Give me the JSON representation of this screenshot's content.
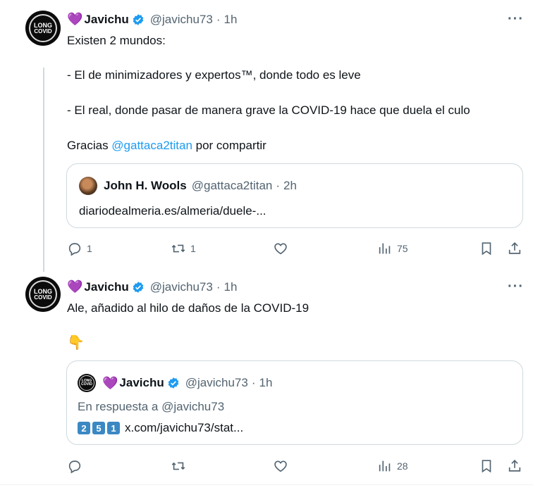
{
  "tweets": [
    {
      "heart": "💜",
      "name": "Javichu",
      "handle": "@javichu73",
      "time": "1h",
      "avatar_text": [
        "LONG",
        "COVID"
      ],
      "lines": [
        "Existen 2 mundos:",
        "-  El de minimizadores y expertos™, donde todo es leve",
        "- El real, donde pasar de manera grave la COVID-19 hace que duela el culo"
      ],
      "thanks_prefix": "Gracias ",
      "thanks_mention": "@gattaca2titan",
      "thanks_suffix": " por compartir",
      "quote": {
        "name": "John H. Wools",
        "handle": "@gattaca2titan",
        "time": "2h",
        "text": "diariodealmeria.es/almeria/duele-..."
      },
      "actions": {
        "replies": "1",
        "retweets": "1",
        "views": "75"
      }
    },
    {
      "heart": "💜",
      "name": "Javichu",
      "handle": "@javichu73",
      "time": "1h",
      "avatar_text": [
        "LONG",
        "COVID"
      ],
      "line": "Ale, añadido al hilo de daños de la COVID-19",
      "emoji": "👇",
      "quote": {
        "heart": "💜",
        "name": "Javichu",
        "handle": "@javichu73",
        "time": "1h",
        "reply_to": "En respuesta a @javichu73",
        "digits": [
          "2",
          "5",
          "1"
        ],
        "text": "x.com/javichu73/stat..."
      },
      "actions": {
        "views": "28"
      }
    }
  ],
  "colors": {
    "accent": "#1d9bf0",
    "muted": "#536471",
    "heart": "#b07ad6"
  },
  "icons": [
    "more-icon",
    "verified-icon",
    "reply-icon",
    "retweet-icon",
    "like-icon",
    "views-icon",
    "bookmark-icon",
    "share-icon"
  ]
}
